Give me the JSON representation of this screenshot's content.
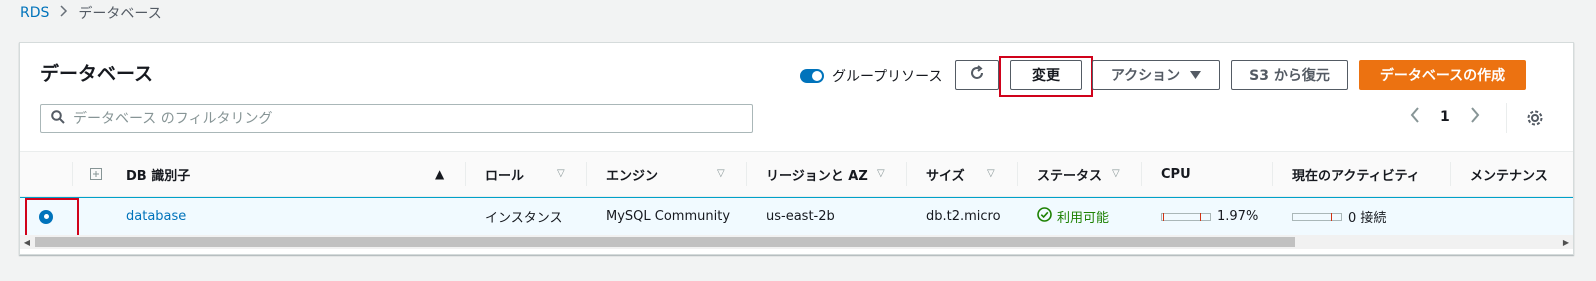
{
  "breadcrumb": {
    "root": "RDS",
    "current": "データベース"
  },
  "panel": {
    "title": "データベース"
  },
  "toolbar": {
    "group_toggle_label": "グループリソース",
    "modify_label": "変更",
    "actions_label": "アクション",
    "restore_s3_label": "S3 から復元",
    "create_label": "データベースの作成"
  },
  "search": {
    "placeholder": "データベース のフィルタリング"
  },
  "pagination": {
    "page": "1"
  },
  "table": {
    "headers": {
      "db_id": "DB 識別子",
      "role": "ロール",
      "engine": "エンジン",
      "region": "リージョンと AZ",
      "size": "サイズ",
      "status": "ステータス",
      "cpu": "CPU",
      "activity": "現在のアクティビティ",
      "maintenance": "メンテナンス"
    },
    "rows": [
      {
        "db_id": "database",
        "role": "インスタンス",
        "engine": "MySQL Community",
        "region": "us-east-2b",
        "size": "db.t2.micro",
        "status": "利用可能",
        "cpu": "1.97%",
        "cpu_level": 0.0197,
        "activity": "0 接続"
      }
    ]
  },
  "colors": {
    "accent": "#0073bb",
    "primary_button": "#ec7211",
    "highlight": "#d0021b",
    "status_ok": "#1d8102"
  }
}
